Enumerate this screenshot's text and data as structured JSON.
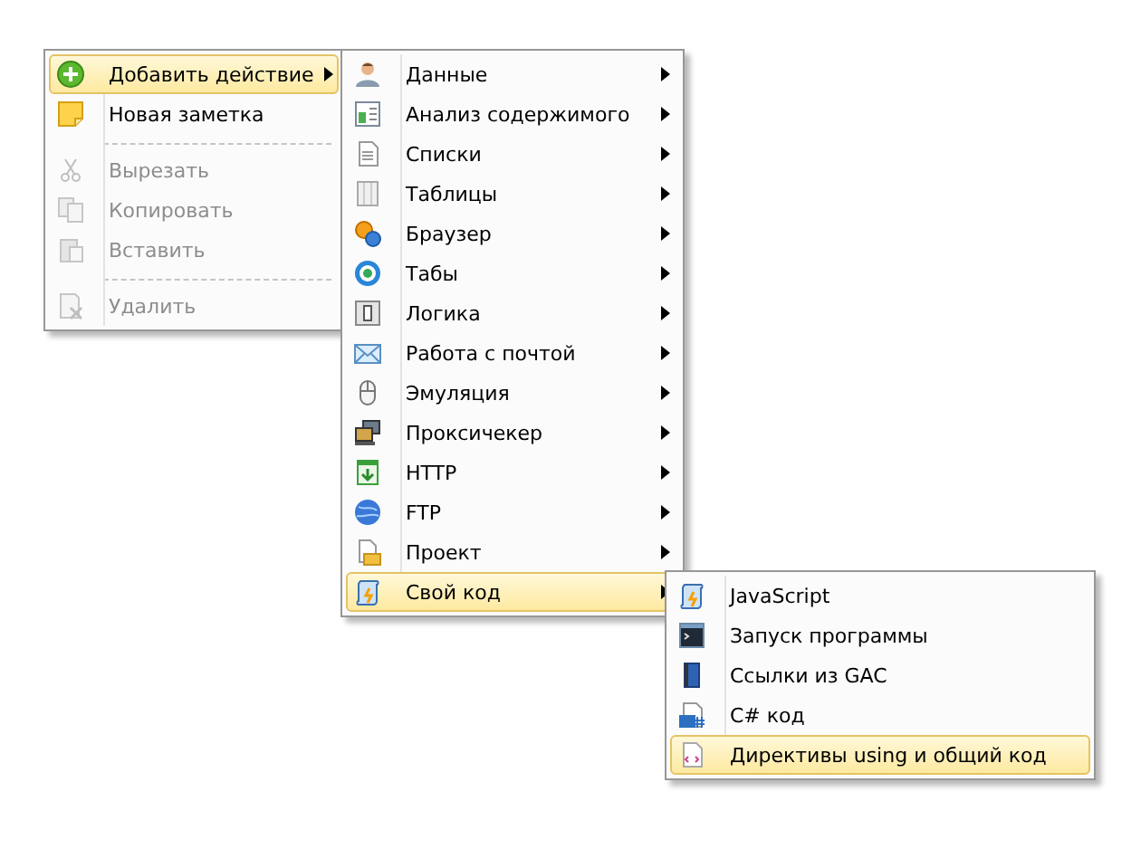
{
  "menus": [
    {
      "items": [
        {
          "kind": "item",
          "label": "Добавить действие",
          "selected": true,
          "disabled": false,
          "submenu": true
        },
        {
          "kind": "item",
          "label": "Новая заметка",
          "selected": false,
          "disabled": false,
          "submenu": false
        },
        {
          "kind": "separator"
        },
        {
          "kind": "item",
          "label": "Вырезать",
          "selected": false,
          "disabled": true,
          "submenu": false
        },
        {
          "kind": "item",
          "label": "Копировать",
          "selected": false,
          "disabled": true,
          "submenu": false
        },
        {
          "kind": "item",
          "label": "Вставить",
          "selected": false,
          "disabled": true,
          "submenu": false
        },
        {
          "kind": "separator"
        },
        {
          "kind": "item",
          "label": "Удалить",
          "selected": false,
          "disabled": true,
          "submenu": false
        }
      ]
    },
    {
      "items": [
        {
          "kind": "item",
          "label": "Данные",
          "selected": false,
          "disabled": false,
          "submenu": true
        },
        {
          "kind": "item",
          "label": "Анализ содержимого",
          "selected": false,
          "disabled": false,
          "submenu": true
        },
        {
          "kind": "item",
          "label": "Списки",
          "selected": false,
          "disabled": false,
          "submenu": true
        },
        {
          "kind": "item",
          "label": "Таблицы",
          "selected": false,
          "disabled": false,
          "submenu": true
        },
        {
          "kind": "item",
          "label": "Браузер",
          "selected": false,
          "disabled": false,
          "submenu": true
        },
        {
          "kind": "item",
          "label": "Табы",
          "selected": false,
          "disabled": false,
          "submenu": true
        },
        {
          "kind": "item",
          "label": "Логика",
          "selected": false,
          "disabled": false,
          "submenu": true
        },
        {
          "kind": "item",
          "label": "Работа с почтой",
          "selected": false,
          "disabled": false,
          "submenu": true
        },
        {
          "kind": "item",
          "label": "Эмуляция",
          "selected": false,
          "disabled": false,
          "submenu": true
        },
        {
          "kind": "item",
          "label": "Проксичекер",
          "selected": false,
          "disabled": false,
          "submenu": true
        },
        {
          "kind": "item",
          "label": "HTTP",
          "selected": false,
          "disabled": false,
          "submenu": true
        },
        {
          "kind": "item",
          "label": "FTP",
          "selected": false,
          "disabled": false,
          "submenu": true
        },
        {
          "kind": "item",
          "label": "Проект",
          "selected": false,
          "disabled": false,
          "submenu": true
        },
        {
          "kind": "item",
          "label": "Свой код",
          "selected": true,
          "disabled": false,
          "submenu": true
        }
      ]
    },
    {
      "items": [
        {
          "kind": "item",
          "label": "JavaScript",
          "selected": false,
          "disabled": false,
          "submenu": false
        },
        {
          "kind": "item",
          "label": "Запуск программы",
          "selected": false,
          "disabled": false,
          "submenu": false
        },
        {
          "kind": "item",
          "label": "Ссылки из GAC",
          "selected": false,
          "disabled": false,
          "submenu": false
        },
        {
          "kind": "item",
          "label": "C# код",
          "selected": false,
          "disabled": false,
          "submenu": false
        },
        {
          "kind": "item",
          "label": "Директивы using и общий код",
          "selected": true,
          "disabled": false,
          "submenu": false
        }
      ]
    }
  ]
}
